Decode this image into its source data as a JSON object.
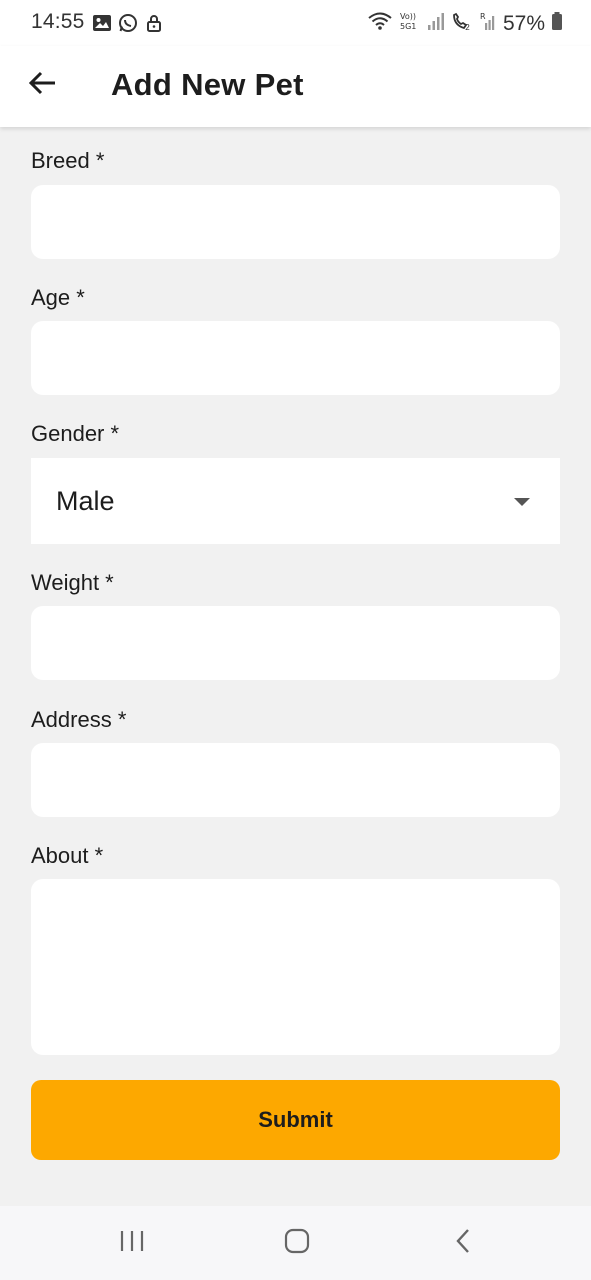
{
  "status_bar": {
    "time": "14:55",
    "battery_text": "57%",
    "left_icons": [
      "gallery-icon",
      "whatsapp-icon",
      "lock-icon"
    ],
    "right_icons": [
      "wifi-icon",
      "volte-5g-icon",
      "signal-icon",
      "wifi-calling-icon",
      "signal-roaming-icon",
      "battery-icon"
    ]
  },
  "app_bar": {
    "title": "Add New Pet",
    "back_icon": "arrow-left-icon"
  },
  "form": {
    "breed": {
      "label": "Breed *",
      "value": "",
      "placeholder": ""
    },
    "age": {
      "label": "Age *",
      "value": "",
      "placeholder": ""
    },
    "gender": {
      "label": "Gender *",
      "selected": "Male"
    },
    "weight": {
      "label": "Weight *",
      "value": "",
      "placeholder": ""
    },
    "address": {
      "label": "Address *",
      "value": "",
      "placeholder": ""
    },
    "about": {
      "label": "About *",
      "value": "",
      "placeholder": ""
    },
    "submit_label": "Submit"
  },
  "nav_bar": {
    "icons": [
      "recent-apps-icon",
      "home-icon",
      "back-icon"
    ]
  },
  "colors": {
    "accent": "#fda800",
    "background": "#f1f1f1",
    "surface": "#ffffff"
  }
}
